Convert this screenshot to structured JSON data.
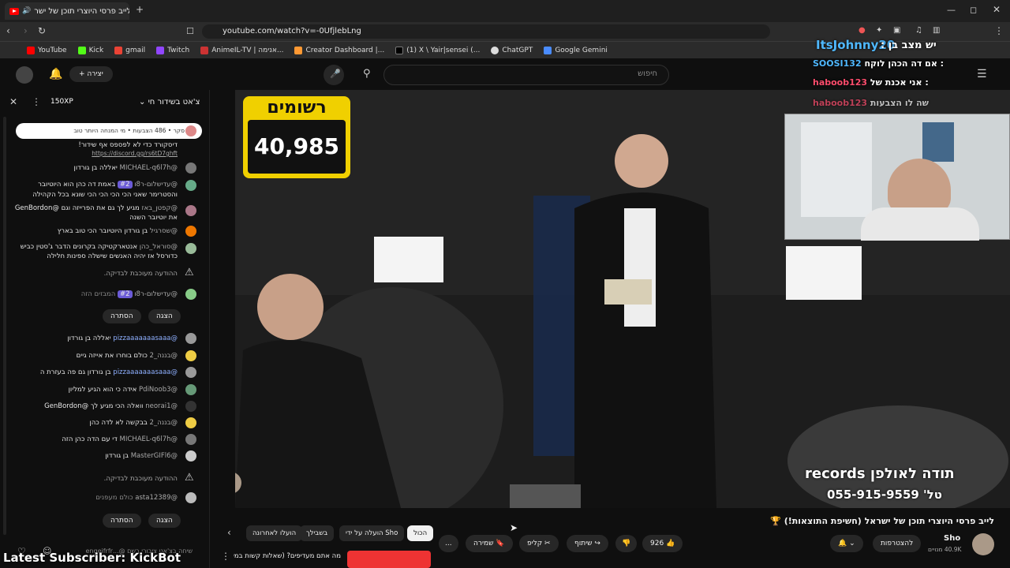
{
  "browser": {
    "tab_title": "לייב פרסי היוצרי תוכן של ישר",
    "url": "youtube.com/watch?v=-0UfjlebLng",
    "bookmarks": [
      "YouTube",
      "Kick",
      "gmail",
      "Twitch",
      "AnimeIL-TV | אנימה...",
      "Creator Dashboard |...",
      "(1) X \\ Yair|sensei (...",
      "ChatGPT",
      "Google Gemini"
    ]
  },
  "youtube_header": {
    "search_placeholder": "חיפוש",
    "create_label": "יצירה"
  },
  "chat": {
    "title": "צ'אט בשידור חי",
    "xp_badge": "150XP",
    "poll": "סקר • 486 הצבעות • מי המנחה היותר טוב",
    "discord_msg": "דיסקורד כדי לא לפספס אף שידור!",
    "discord_link": "https://discord.gg/rs6tD7ghft",
    "messages": [
      {
        "user": "@MICHAEL-q6l7h",
        "text": "יאללה בן גורדון"
      },
      {
        "user": "@עדישלום-ר8ו",
        "badge": "#2",
        "text": "באמת דה כהן הוא היוטיובר והסטרימר שאני הכי הכי הכי הכי שונא בכל הקהילה"
      },
      {
        "user": "@קפטן_באז",
        "text": "מגיע לך גם את הפרייזה וגם @GenBordon את יוטיובר השנה"
      },
      {
        "user": "@שסרגיל",
        "text": "בן גורדון היוטיובר הכי טוב בארץ"
      },
      {
        "user": "@סוראל_כהן",
        "text": "אנטארקטיקה בקרונים הדבר ג'סטין כביש כדורסל אז יהיה האנשים שישלה ספינות חלילה"
      },
      {
        "user": "@pizzaaaaaaasaaa",
        "text": "יאללה בן גורדון"
      },
      {
        "user": "@בננה_2",
        "text": "כולם בוחרו את אייזה גיים"
      },
      {
        "user": "@pizzaaaaaaasaaa",
        "text": "בן גורדון גם פה בעזרת ה"
      },
      {
        "user": "@PdiNoob3",
        "text": "אידה כי הוא הגיע למליון"
      },
      {
        "user": "@neorai1",
        "text": "וואלה הכי מגיע לך @GenBordon"
      },
      {
        "user": "@בננה_2",
        "text": "בבקשה לא לדה כהן"
      },
      {
        "user": "@MICHAEL-q6l7h",
        "text": "די עם הדה כהן הזה"
      },
      {
        "user": "@MasterGIFl6",
        "text": "בן גורדון"
      },
      {
        "user": "@asta12389",
        "text": "כולם מעפנים"
      }
    ],
    "held_message": "ההודעה מעוכבת לבדיקה.",
    "held_user": "@עדישלום-ר8ו",
    "held_badge": "#2",
    "held_text": "המבזים הזה",
    "show_label": "הצגה",
    "hide_label": "הסתרה",
    "input_placeholder": "שיחה בצ'אט ציבורי בשם @...engeifrfr"
  },
  "video": {
    "viewers_title": "רשומים",
    "viewers_count": "40,985",
    "sponsor_line1": "תודה לאולפן records",
    "sponsor_line2": "טל' 055-915-9559",
    "overlay_streamer": "ItsJohnny20",
    "overlay_top": "יש מצב בן :",
    "overlay_lines": [
      {
        "text": "אם דה הכהן לוקח :",
        "user": "SOOSI132"
      },
      {
        "text": "אני אכנת של :",
        "user": "haboob123"
      },
      {
        "text": "שה לו הצבעות",
        "user": "haboob123"
      }
    ],
    "bottom_banner": "Latest Subscriber: KickBot"
  },
  "info": {
    "video_title": "לייב פרסי היוצרי תוכן של ישראל (חשיפת התוצאות!) 🏆",
    "channel": "Sho",
    "subscribers": "40.9K מנויים",
    "subscribe_label": "להצטרפות",
    "like_count": "926",
    "share_label": "שיתוף",
    "clip_label": "קליפ",
    "save_label": "שמירה",
    "more_label": "...",
    "chips": [
      "הכול",
      "הועלה על ידי Sho",
      "בשבילך",
      "הועלו לאחרונה"
    ],
    "rec_title": "מה אתם מעדיפים? (שאלות קשות במיוחד)"
  },
  "colors": {
    "accent": "#ff0000",
    "viewer_box": "#f0d000",
    "overlay_user": "#4fb8ff",
    "overlay_user2": "#ff4d6d"
  }
}
